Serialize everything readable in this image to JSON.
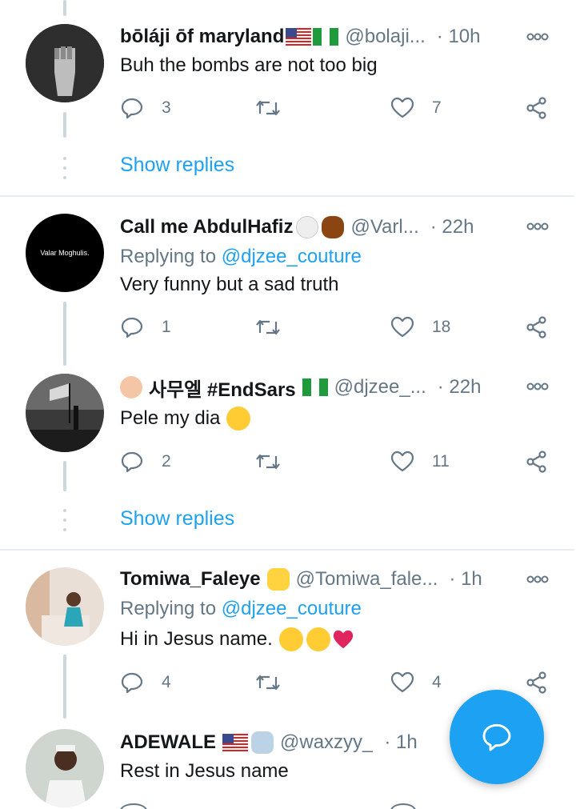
{
  "tweets": [
    {
      "name": "bōláji ōf maryland",
      "handle": "@bolaji...",
      "time": "· 10h",
      "text": "Buh the bombs are not too big",
      "replies": "3",
      "likes": "7"
    },
    {
      "name": "Call me AbdulHafiz",
      "handle": "@Varl...",
      "time": "· 22h",
      "replying_prefix": "Replying to",
      "replying_to": "@djzee_couture",
      "text": "Very funny but a sad truth",
      "replies": "1",
      "likes": "18",
      "avatar_text": "Valar Moghulis."
    },
    {
      "name": "사무엘 #EndSars",
      "handle": "@djzee_...",
      "time": "· 22h",
      "text": "Pele my dia",
      "replies": "2",
      "likes": "11"
    },
    {
      "name": "Tomiwa_Faleye",
      "handle": "@Tomiwa_fale...",
      "time": "· 1h",
      "replying_prefix": "Replying to",
      "replying_to": "@djzee_couture",
      "text": "Hi in Jesus name.",
      "replies": "4",
      "likes": "4"
    },
    {
      "name": "ADEWALE",
      "handle": "@waxzyy_",
      "time": "· 1h",
      "text": "Rest in Jesus name"
    }
  ],
  "show_replies_label": "Show replies",
  "colors": {
    "accent": "#1da1f2",
    "secondary_text": "#657786",
    "thread_line": "#ccd6dd",
    "divider": "#e6ecf0"
  },
  "icons": [
    "more-icon",
    "reply-icon",
    "retweet-icon",
    "like-icon",
    "share-icon",
    "compose-icon"
  ]
}
